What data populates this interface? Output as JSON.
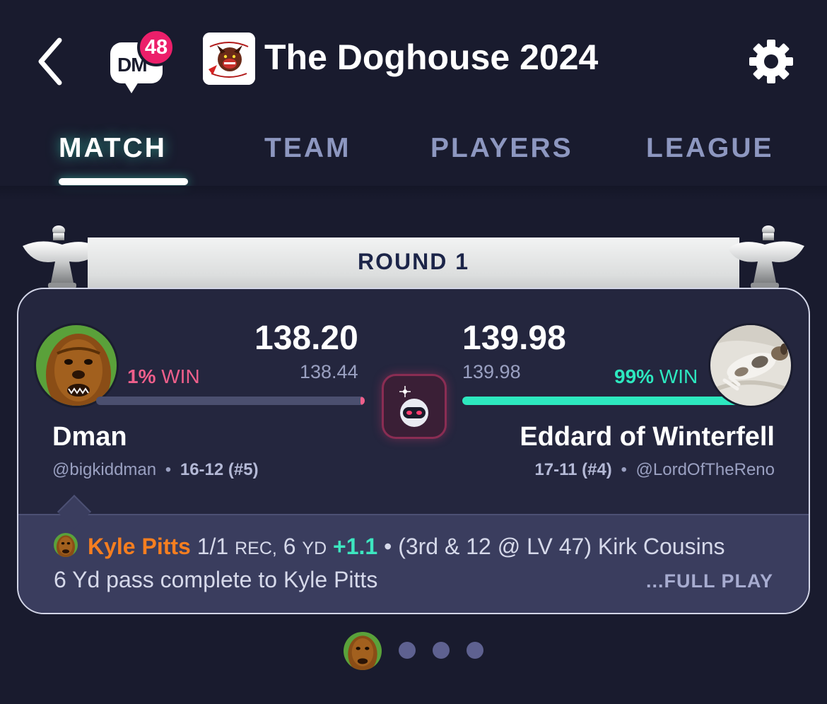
{
  "header": {
    "dm_label": "DM",
    "dm_badge": "48",
    "league_title": "The Doghouse 2024",
    "league_logo_icon": "doghouse-logo-icon"
  },
  "tabs": [
    {
      "label": "MATCH",
      "active": true
    },
    {
      "label": "TEAM",
      "active": false
    },
    {
      "label": "PLAYERS",
      "active": false
    },
    {
      "label": "LEAGUE",
      "active": false
    }
  ],
  "matchup": {
    "round_label": "ROUND 1",
    "left_team": {
      "name": "Dman",
      "handle": "@bigkiddman",
      "record": "16-12 (#5)",
      "score": "138.20",
      "projected": "138.44",
      "win_pct": "1%",
      "win_label": "WIN",
      "win_fraction": 0.01,
      "avatar_icon": "chewbacca-avatar"
    },
    "right_team": {
      "name": "Eddard of Winterfell",
      "handle": "@LordOfTheReno",
      "record": "17-11 (#4)",
      "score": "139.98",
      "projected": "139.98",
      "win_pct": "99%",
      "win_label": "WIN",
      "win_fraction": 0.99,
      "avatar_icon": "dog-photo-avatar"
    },
    "separator": "•",
    "vs_icon": "robot-mascot-icon"
  },
  "play": {
    "player": "Kyle Pitts",
    "stat_count": "1/1",
    "stat_rec": "REC,",
    "stat_yds_num": "6",
    "stat_yds_unit": "YD",
    "points": "+1.1",
    "description": "• (3rd & 12 @ LV 47) Kirk Cousins 6 Yd pass complete to Kyle Pitts",
    "full_play_label": "...FULL PLAY"
  },
  "pager": {
    "total": 4,
    "current": 1
  },
  "colors": {
    "background": "#191b2e",
    "accent_teal": "#2de8bf",
    "lose_pink": "#ee5f8b",
    "player_orange": "#f57e20",
    "badge_pink": "#ec1f6a"
  }
}
